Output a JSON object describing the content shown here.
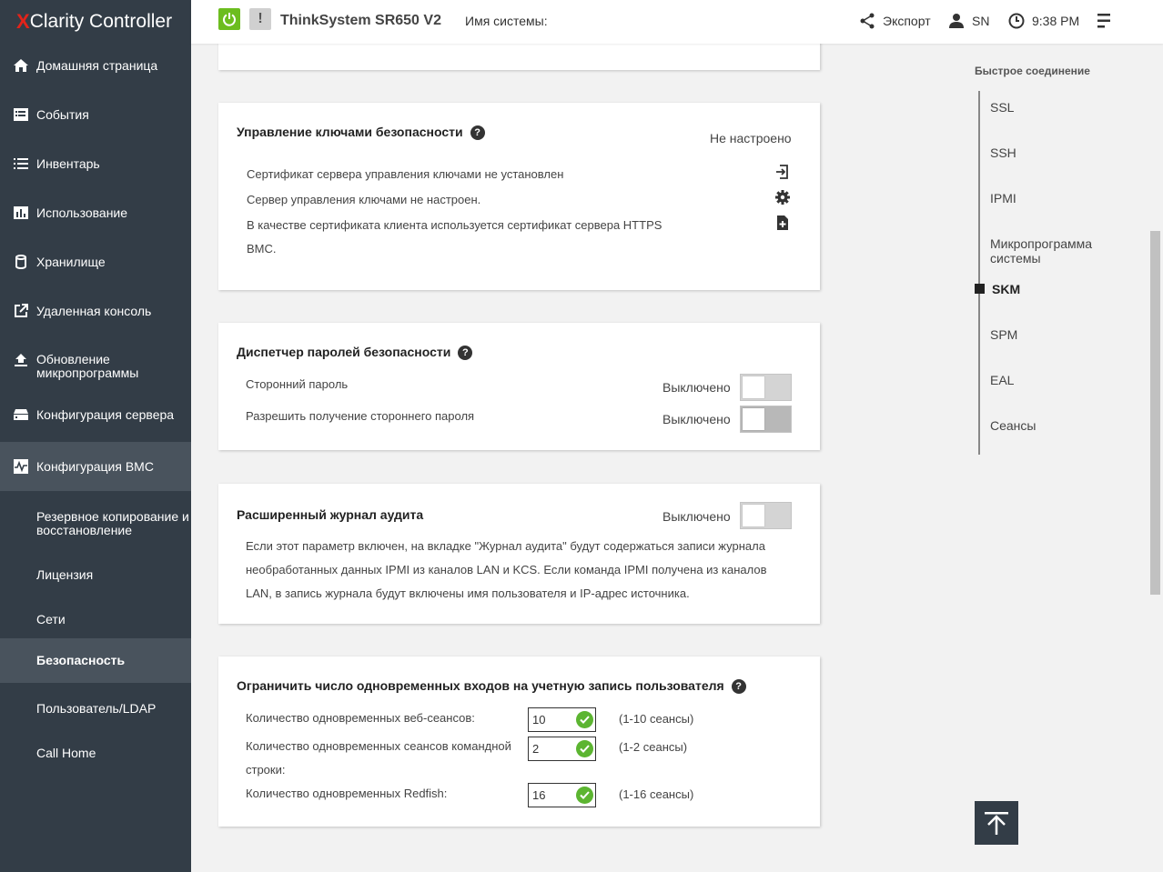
{
  "app": {
    "logo_x": "X",
    "logo_rest": "Clarity",
    "logo_suffix": " Controller"
  },
  "header": {
    "model": "ThinkSystem SR650 V2",
    "system_name_label": "Имя системы:",
    "export_label": "Экспорт",
    "user_label": "SN",
    "time": "9:38 PM"
  },
  "sidebar": {
    "items": [
      {
        "label": "Домашняя страница",
        "icon": "home-icon"
      },
      {
        "label": "События",
        "icon": "events-icon"
      },
      {
        "label": "Инвентарь",
        "icon": "list-icon"
      },
      {
        "label": "Использование",
        "icon": "chart-icon"
      },
      {
        "label": "Хранилище",
        "icon": "storage-icon"
      },
      {
        "label": "Удаленная консоль",
        "icon": "external-icon"
      },
      {
        "label": "Обновление микропрограммы",
        "icon": "upload-icon"
      },
      {
        "label": "Конфигурация сервера",
        "icon": "server-icon"
      },
      {
        "label": "Конфигурация BMC",
        "icon": "bmc-icon"
      }
    ],
    "subitems": [
      {
        "label": "Резервное копирование и восстановление"
      },
      {
        "label": "Лицензия"
      },
      {
        "label": "Сети"
      },
      {
        "label": "Безопасность"
      },
      {
        "label": "Пользователь/LDAP"
      },
      {
        "label": "Call Home"
      }
    ]
  },
  "skm": {
    "title": "Управление ключами безопасности",
    "status": "Не настроено",
    "lines": [
      "Сертификат сервера управления ключами не установлен",
      "Сервер управления ключами не настроен.",
      "В качестве сертификата клиента используется сертификат сервера HTTPS BMC."
    ]
  },
  "spm": {
    "title": "Диспетчер паролей безопасности",
    "rows": [
      {
        "label": "Сторонний пароль",
        "status": "Выключено"
      },
      {
        "label": "Разрешить получение стороннего пароля",
        "status": "Выключено"
      }
    ]
  },
  "eal": {
    "title": "Расширенный журнал аудита",
    "status": "Выключено",
    "description": "Если этот параметр включен, на вкладке \"Журнал аудита\" будут содержаться записи журнала необработанных данных IPMI из каналов LAN и KCS. Если команда IPMI получена из каналов LAN, в запись журнала будут включены имя пользователя и IP-адрес источника."
  },
  "sessions": {
    "title": "Ограничить число одновременных входов на учетную запись пользователя",
    "rows": [
      {
        "label": "Количество одновременных веб-сеансов:",
        "value": "10",
        "range": "(1-10 сеансы)"
      },
      {
        "label": "Количество одновременных сеансов командной строки:",
        "value": "2",
        "range": "(1-2 сеансы)"
      },
      {
        "label": "Количество одновременных Redfish:",
        "value": "16",
        "range": "(1-16 сеансы)"
      }
    ]
  },
  "anchors": {
    "title": "Быстрое соединение",
    "items": [
      "SSL",
      "SSH",
      "IPMI",
      "Микропрограмма системы",
      "SKM",
      "SPM",
      "EAL",
      "Сеансы"
    ]
  },
  "colors": {
    "sidebar": "#333d47",
    "power": "#6cbd1f",
    "check": "#5cb531",
    "brand_red": "#e2231a"
  }
}
